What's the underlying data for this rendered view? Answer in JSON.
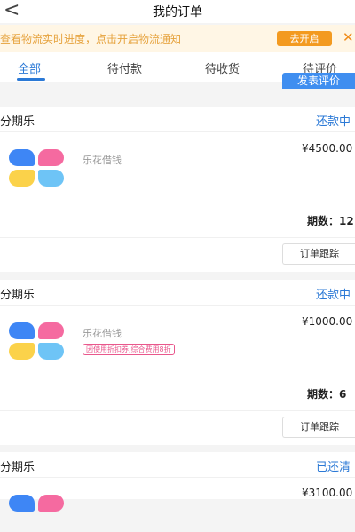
{
  "nav": {
    "back_icon": "<",
    "title": "我的订单"
  },
  "notice": {
    "text": "查看物流实时进度，点击开启物流通知",
    "button": "去开启",
    "close_icon": "✕"
  },
  "tabs": [
    {
      "label": "全部",
      "active": true
    },
    {
      "label": "待付款",
      "active": false
    },
    {
      "label": "待收货",
      "active": false
    },
    {
      "label": "待评价",
      "active": false
    }
  ],
  "review_button": "发表评价",
  "orders": [
    {
      "merchant": "分期乐",
      "status": "还款中",
      "product": "乐花借钱",
      "discount_tag": "",
      "price": "¥4500.00",
      "term_label": "期数：12",
      "track_button": "订单跟踪"
    },
    {
      "merchant": "分期乐",
      "status": "还款中",
      "product": "乐花借钱",
      "discount_tag": "因使用折扣券,综合费用8折",
      "price": "¥1000.00",
      "term_label": "期数：6",
      "track_button": "订单跟踪"
    },
    {
      "merchant": "分期乐",
      "status": "已还清",
      "product": "",
      "discount_tag": "",
      "price": "¥3100.00",
      "term_label": "",
      "track_button": ""
    }
  ],
  "colors": {
    "accent": "#2b79d6",
    "notice_bg": "#fff6e5",
    "notice_text": "#e6a23c",
    "notice_button": "#f39a20"
  }
}
